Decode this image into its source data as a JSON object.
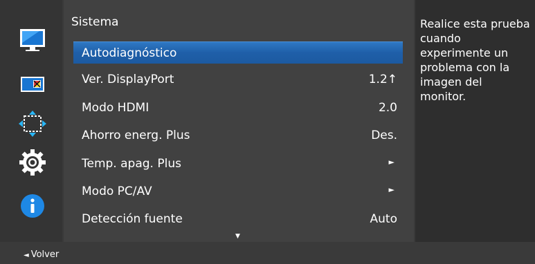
{
  "sidebar": {
    "icons": [
      "monitor-icon",
      "color-screen-icon",
      "move-size-icon",
      "gear-icon",
      "info-icon"
    ],
    "selected": "gear-icon"
  },
  "main": {
    "title": "Sistema",
    "items": [
      {
        "label": "Autodiagnóstico",
        "value": "",
        "selected": true
      },
      {
        "label": "Ver. DisplayPort",
        "value": "1.2↑"
      },
      {
        "label": "Modo HDMI",
        "value": "2.0"
      },
      {
        "label": "Ahorro energ. Plus",
        "value": "Des."
      },
      {
        "label": "Temp. apag. Plus",
        "value": "►"
      },
      {
        "label": "Modo PC/AV",
        "value": "►"
      },
      {
        "label": "Detección fuente",
        "value": "Auto"
      }
    ],
    "scroll_indicator": "▼"
  },
  "help": {
    "text": "Realice esta prueba cuando experimente un problema con la imagen del monitor."
  },
  "bottom": {
    "back_icon": "◄",
    "back_label": "Volver"
  },
  "colors": {
    "highlight": "#1f5fa8",
    "info_icon": "#1e88e5",
    "panel": "#414141"
  }
}
